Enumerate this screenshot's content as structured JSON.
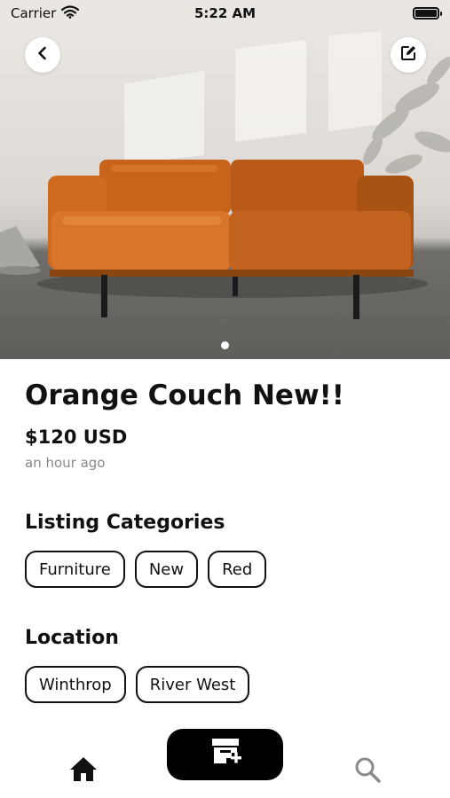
{
  "status_bar": {
    "carrier": "Carrier",
    "time": "5:22 AM",
    "wifi_icon": "wifi-icon",
    "battery_icon": "battery-icon",
    "battery_level": 1.0
  },
  "hero": {
    "image_alt": "orange leather couch",
    "page_count": 1,
    "current_page": 1
  },
  "header_buttons": {
    "back_icon": "chevron-left-icon",
    "edit_icon": "edit-icon"
  },
  "listing": {
    "title": "Orange Couch New!!",
    "price": "$120 USD",
    "posted": "an hour ago"
  },
  "categories": {
    "heading": "Listing Categories",
    "items": [
      "Furniture",
      "New",
      "Red"
    ]
  },
  "location": {
    "heading": "Location",
    "items": [
      "Winthrop",
      "River West"
    ]
  },
  "tab_bar": {
    "home_icon": "home-icon",
    "add_icon": "add-listing-icon",
    "search_icon": "search-icon"
  },
  "colors": {
    "accent": "#000000",
    "couch": "#d26a1e",
    "muted_text": "#888888"
  }
}
